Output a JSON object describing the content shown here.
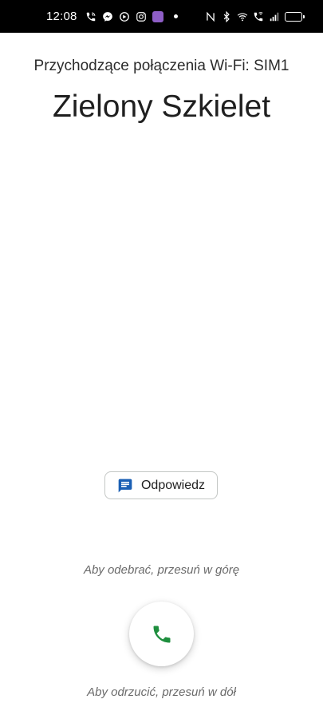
{
  "status_bar": {
    "time": "12:08",
    "left_icons": [
      "wifi-call-icon",
      "messenger-icon",
      "viber-icon",
      "instagram-icon",
      "app-badge-icon",
      "notification-dot"
    ],
    "right_icons": [
      "nfc-icon",
      "bluetooth-icon",
      "wifi-icon",
      "wifi-calling-icon",
      "signal-icon",
      "battery-icon"
    ]
  },
  "call": {
    "subtitle": "Przychodzące połączenia Wi-Fi: SIM1",
    "caller_name": "Zielony Szkielet"
  },
  "actions": {
    "reply_label": "Odpowiedz",
    "reply_icon": "message-icon",
    "answer_icon": "phone-icon",
    "hint_answer": "Aby odebrać, przesuń w górę",
    "hint_decline": "Aby odrzucić, przesuń w dół"
  },
  "colors": {
    "status_bar_bg": "#000000",
    "reply_icon": "#1a5fb4",
    "answer_icon": "#1e8e3e",
    "hint_text": "#6b6b6b"
  }
}
